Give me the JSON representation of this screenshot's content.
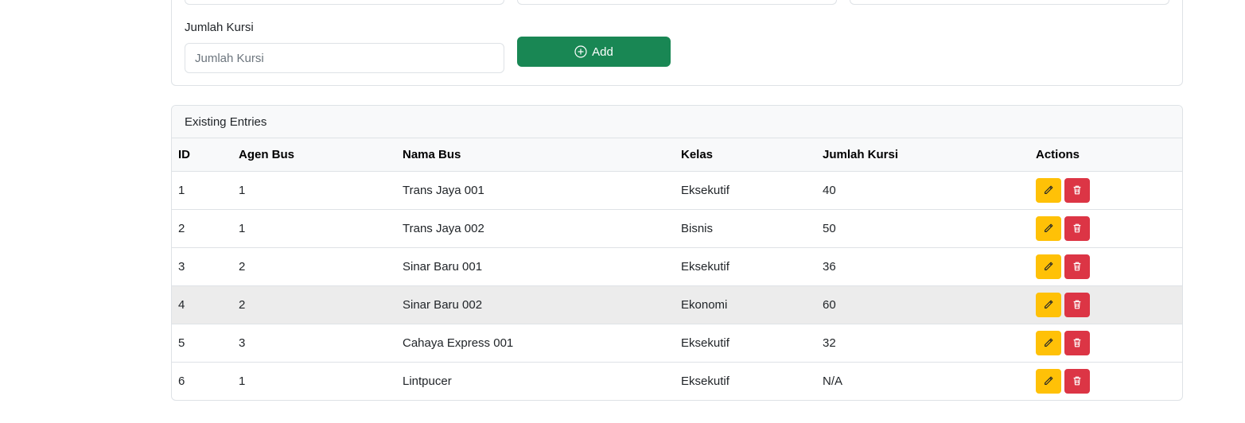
{
  "form": {
    "label": "Jumlah Kursi",
    "input_placeholder": "Jumlah Kursi",
    "input_value": "",
    "add_label": "Add"
  },
  "table": {
    "header": "Existing Entries",
    "columns": [
      "ID",
      "Agen Bus",
      "Nama Bus",
      "Kelas",
      "Jumlah Kursi",
      "Actions"
    ],
    "rows": [
      {
        "id": "1",
        "agen": "1",
        "nama": "Trans Jaya 001",
        "kelas": "Eksekutif",
        "kursi": "40"
      },
      {
        "id": "2",
        "agen": "1",
        "nama": "Trans Jaya 002",
        "kelas": "Bisnis",
        "kursi": "50"
      },
      {
        "id": "3",
        "agen": "2",
        "nama": "Sinar Baru 001",
        "kelas": "Eksekutif",
        "kursi": "36"
      },
      {
        "id": "4",
        "agen": "2",
        "nama": "Sinar Baru 002",
        "kelas": "Ekonomi",
        "kursi": "60"
      },
      {
        "id": "5",
        "agen": "3",
        "nama": "Cahaya Express 001",
        "kelas": "Eksekutif",
        "kursi": "32"
      },
      {
        "id": "6",
        "agen": "1",
        "nama": "Lintpucer",
        "kelas": "Eksekutif",
        "kursi": "N/A"
      }
    ]
  },
  "icons": {
    "add": "plus-circle-icon",
    "edit": "pencil-icon",
    "delete": "trash-icon"
  },
  "colors": {
    "add_button": "#198754",
    "edit_button": "#ffc107",
    "delete_button": "#dc3545"
  }
}
